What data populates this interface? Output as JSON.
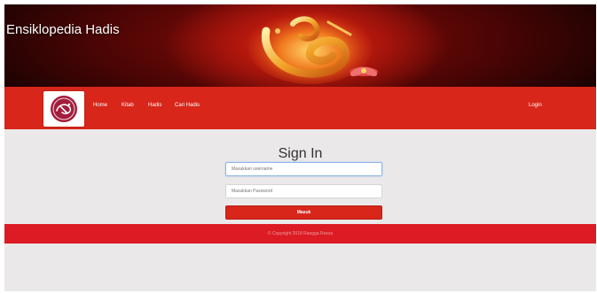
{
  "header": {
    "site_title": "Ensiklopedia Hadis",
    "banner_icon": "calligraphy-flower-banner"
  },
  "navbar": {
    "logo_icon": "calligraphy-logo-icon",
    "items": [
      {
        "label": "Home"
      },
      {
        "label": "Kitab"
      },
      {
        "label": "Hadis"
      },
      {
        "label": "Cari Hadis"
      }
    ],
    "login_label": "Login"
  },
  "signin": {
    "title": "Sign In",
    "username_placeholder": "Masukkan username",
    "password_placeholder": "Masukkan Password",
    "submit_label": "Masuk"
  },
  "footer": {
    "copyright": "© Copyright 2018 Rangga Rosza"
  },
  "colors": {
    "navbar": "#d8261a",
    "footer": "#dc1b24",
    "page_background": "#ebe8e9"
  }
}
